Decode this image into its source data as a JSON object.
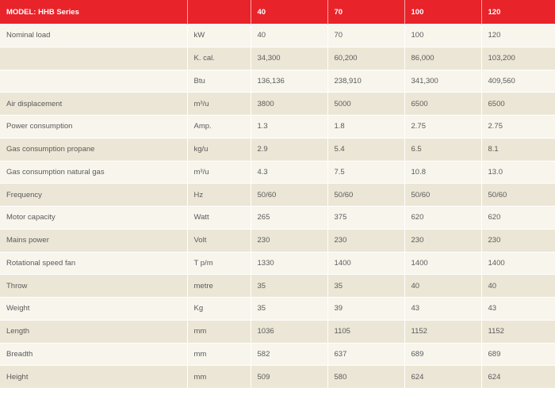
{
  "table": {
    "header": [
      "MODEL: HHB Series",
      "",
      "40",
      "70",
      "100",
      "120"
    ],
    "rows": [
      [
        "Nominal load",
        "kW",
        "40",
        "70",
        "100",
        "120"
      ],
      [
        "",
        "K. cal.",
        "34,300",
        "60,200",
        "86,000",
        "103,200"
      ],
      [
        "",
        "Btu",
        "136,136",
        "238,910",
        "341,300",
        "409,560"
      ],
      [
        "Air displacement",
        "m³/u",
        "3800",
        "5000",
        "6500",
        "6500"
      ],
      [
        "Power consumption",
        "Amp.",
        "1.3",
        "1.8",
        "2.75",
        "2.75"
      ],
      [
        "Gas consumption propane",
        "kg/u",
        "2.9",
        "5.4",
        "6.5",
        "8.1"
      ],
      [
        "Gas consumption natural gas",
        "m³/u",
        "4.3",
        "7.5",
        "10.8",
        "13.0"
      ],
      [
        "Frequency",
        "Hz",
        "50/60",
        "50/60",
        "50/60",
        "50/60"
      ],
      [
        "Motor capacity",
        "Watt",
        "265",
        "375",
        "620",
        "620"
      ],
      [
        "Mains power",
        "Volt",
        "230",
        "230",
        "230",
        "230"
      ],
      [
        "Rotational speed fan",
        "T p/m",
        "1330",
        "1400",
        "1400",
        "1400"
      ],
      [
        "Throw",
        "metre",
        "35",
        "35",
        "40",
        "40"
      ],
      [
        "Weight",
        "Kg",
        "35",
        "39",
        "43",
        "43"
      ],
      [
        "Length",
        "mm",
        "1036",
        "1105",
        "1152",
        "1152"
      ],
      [
        "Breadth",
        "mm",
        "582",
        "637",
        "689",
        "689"
      ],
      [
        "Height",
        "mm",
        "509",
        "580",
        "624",
        "624"
      ]
    ]
  },
  "colors": {
    "header_bg": "#e8232a",
    "header_text": "#ffffff",
    "row_light": "#f8f5ed",
    "row_dark": "#ece6d6",
    "body_text": "#5a5a5a"
  }
}
